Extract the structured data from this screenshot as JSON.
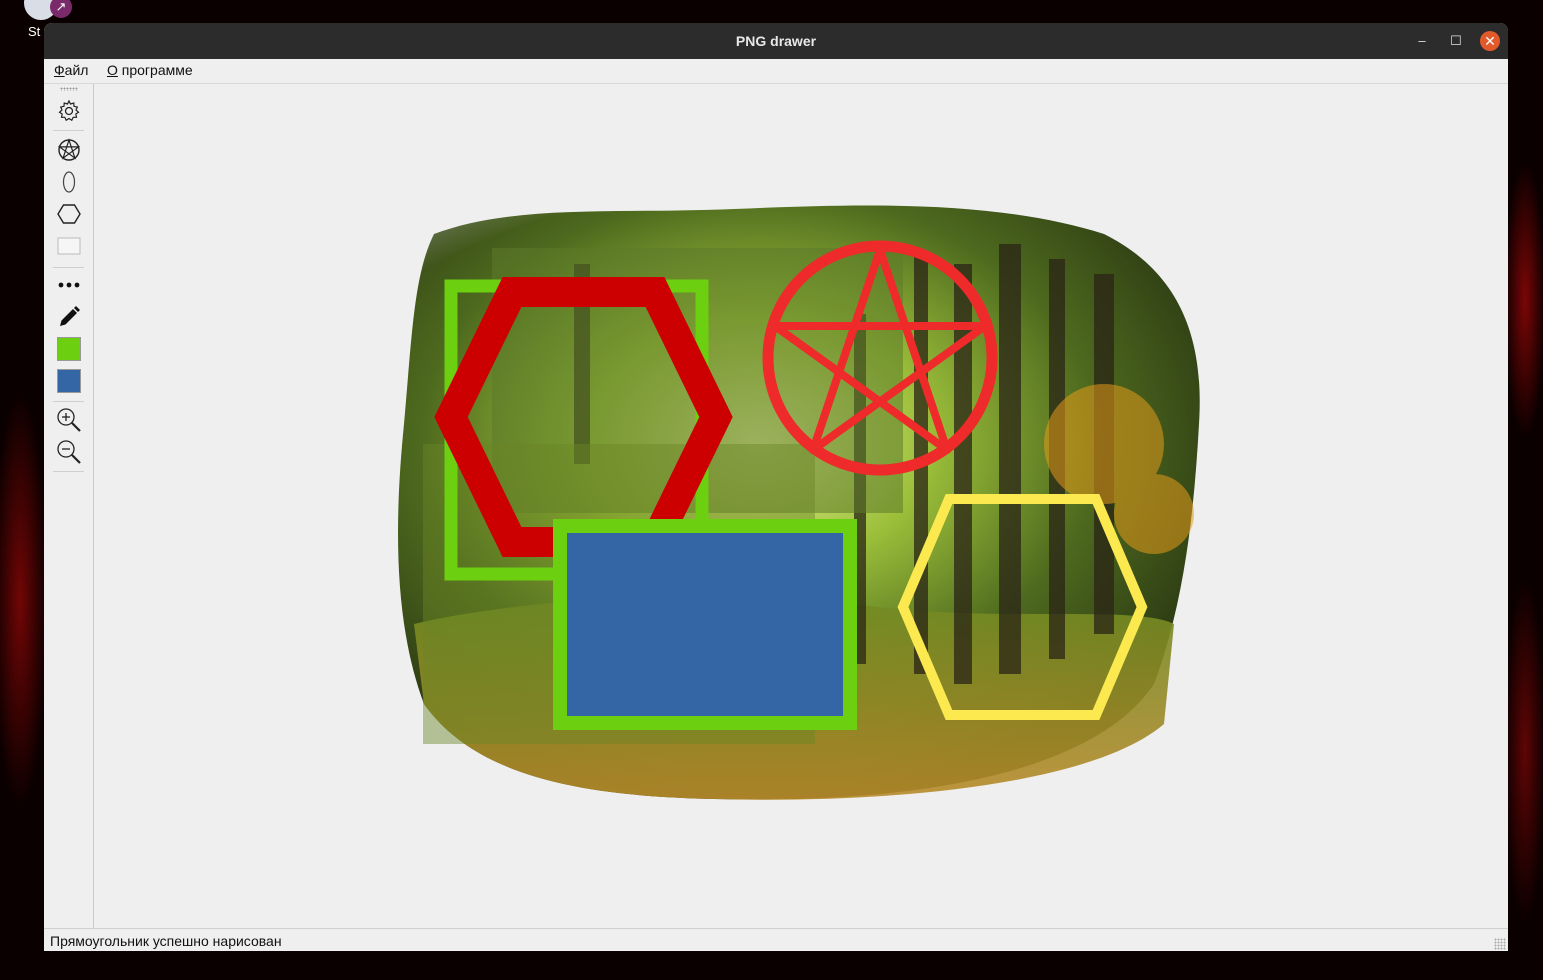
{
  "desktop": {
    "icon_label": "St",
    "icon_name": "steam-app-icon",
    "shortcut_glyph": "↗"
  },
  "window": {
    "title": "PNG drawer",
    "controls": {
      "minimize": "–",
      "maximize": "☐",
      "close": "✕"
    }
  },
  "menu": {
    "file_accel": "Ф",
    "file_rest": "айл",
    "about_accel": "О",
    "about_rest": " программе"
  },
  "toolbar": {
    "tools": [
      {
        "name": "settings-icon"
      },
      {
        "name": "pentagram-tool-icon"
      },
      {
        "name": "ellipse-tool-icon"
      },
      {
        "name": "hexagon-tool-icon"
      },
      {
        "name": "rectangle-tool-icon"
      },
      {
        "name": "line-style-icon"
      },
      {
        "name": "pen-icon"
      },
      {
        "name": "zoom-in-icon"
      },
      {
        "name": "zoom-out-icon"
      }
    ],
    "stroke_color": "#6ccf10",
    "fill_color": "#3465a4"
  },
  "drawing": {
    "colors": {
      "red_hexagon": "#cc0000",
      "green_rect": "#6ccf10",
      "pentagram": "#ee2a2a",
      "blue_fill": "#3465a4",
      "yellow_hexagon": "#fce94f"
    }
  },
  "status": {
    "message": "Прямоугольник успешно нарисован"
  }
}
